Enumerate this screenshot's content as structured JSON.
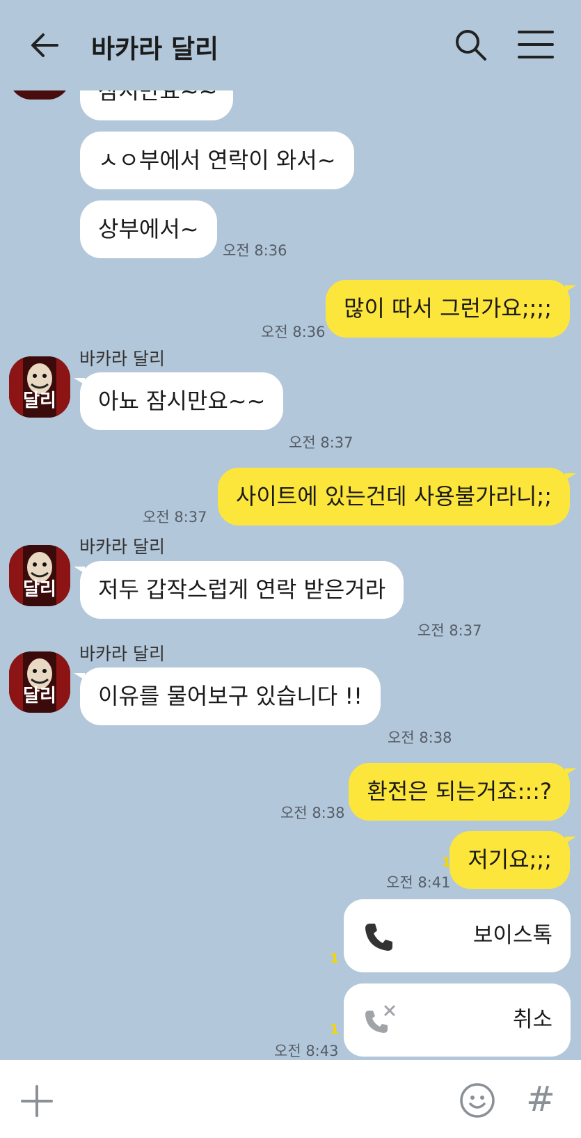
{
  "header": {
    "title": "바카라 달리",
    "back_icon": "arrow-left-icon",
    "search_icon": "search-icon",
    "menu_icon": "hamburger-menu-icon"
  },
  "contact": {
    "name": "바카라 달리",
    "avatar_text": "달리"
  },
  "messages": [
    {
      "from": "in",
      "text": "잠시만요~~"
    },
    {
      "from": "in",
      "text": "ㅅㅇ부에서 연락이 와서~"
    },
    {
      "from": "in",
      "text": "상부에서~",
      "time": "오전 8:36"
    },
    {
      "from": "out",
      "text": "많이 따서 그런가요;;;;",
      "time": "오전 8:36"
    },
    {
      "from": "in",
      "sender": "바카라 달리",
      "text": "아뇨 잠시만요~~",
      "time": "오전 8:37"
    },
    {
      "from": "out",
      "text": "사이트에 있는건데 사용불가라니;;",
      "time": "오전 8:37"
    },
    {
      "from": "in",
      "sender": "바카라 달리",
      "text": "저두 갑작스럽게 연락 받은거라",
      "time": "오전 8:37"
    },
    {
      "from": "in",
      "sender": "바카라 달리",
      "text": "이유를 물어보구 있습니다 !!",
      "time": "오전 8:38"
    },
    {
      "from": "out",
      "text": "환전은 되는거죠:::?",
      "time": "오전 8:38"
    },
    {
      "from": "out",
      "text": "저기요;;;",
      "time": "오전 8:41",
      "unread": "1"
    },
    {
      "from": "out",
      "type": "voice-call",
      "text": "보이스톡",
      "icon": "phone-icon",
      "unread": "1"
    },
    {
      "from": "out",
      "type": "call-canceled",
      "text": "취소",
      "icon": "phone-cancel-icon",
      "time": "오전 8:43",
      "unread": "1"
    }
  ],
  "footer": {
    "plus_icon": "plus-icon",
    "emoji_icon": "emoji-icon",
    "hash_label": "#"
  },
  "colors": {
    "background": "#b2c7da",
    "outgoing_bubble": "#fde63b",
    "incoming_bubble": "#ffffff",
    "unread_count": "#f5d600"
  }
}
